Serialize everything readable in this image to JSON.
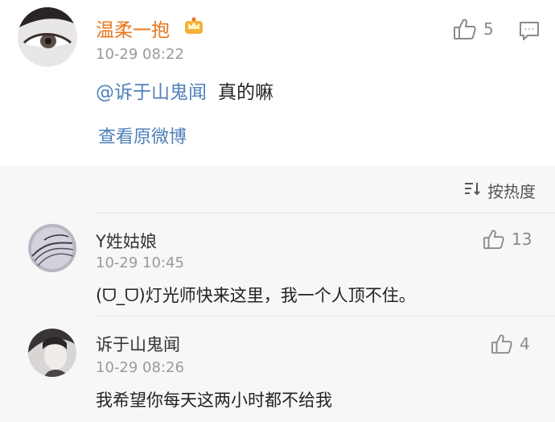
{
  "post": {
    "author": "温柔一抱",
    "time": "10-29 08:22",
    "likes": "5",
    "mention": "@诉于山鬼闻",
    "text": "真的嘛",
    "view_original": "查看原微博"
  },
  "sort": {
    "label": "按热度"
  },
  "comments": [
    {
      "author": "Y姓姑娘",
      "time": "10-29 10:45",
      "likes": "13",
      "text": "(ᗜ_ᗜ)灯光师快来这里，我一个人顶不住。"
    },
    {
      "author": "诉于山鬼闻",
      "time": "10-29 08:26",
      "likes": "4",
      "text": "我希望你每天这两小时都不给我"
    }
  ],
  "colors": {
    "author_orange": "#e8761c",
    "link_blue": "#4f7fba",
    "meta_gray": "#9a9a9a"
  }
}
